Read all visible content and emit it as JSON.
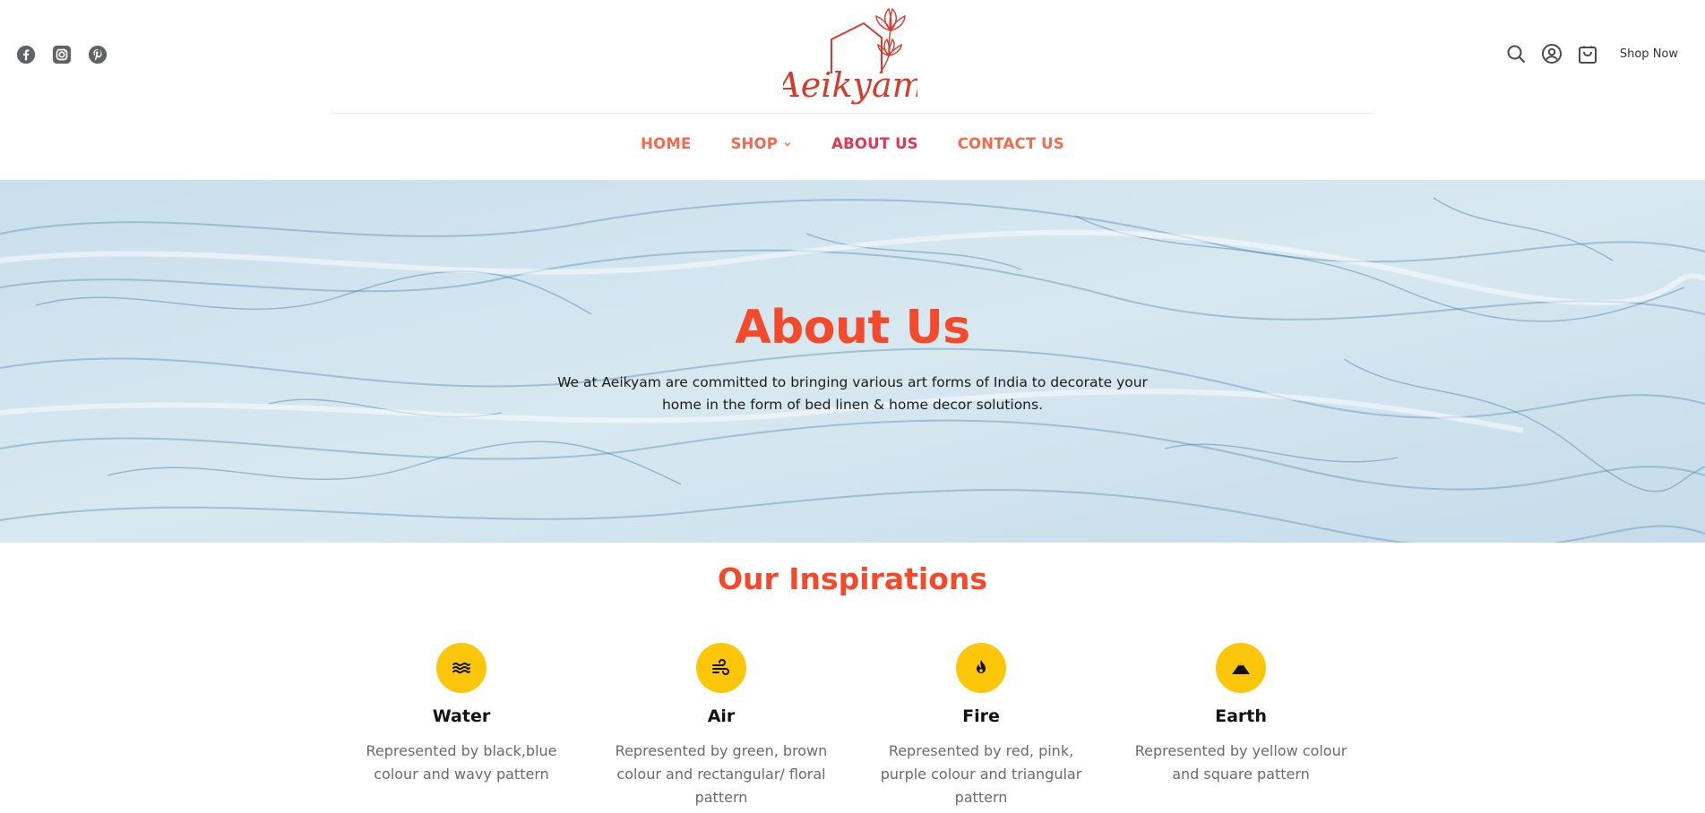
{
  "header": {
    "social_icons": [
      "facebook-icon",
      "instagram-icon",
      "pinterest-icon"
    ],
    "logo_text": "Aeikyam",
    "right_icons": [
      "search-icon",
      "account-icon",
      "cart-icon"
    ],
    "shop_now_label": "Shop Now"
  },
  "nav": {
    "items": [
      {
        "label": "HOME"
      },
      {
        "label": "SHOP"
      },
      {
        "label": "ABOUT US"
      },
      {
        "label": "CONTACT US"
      }
    ]
  },
  "hero": {
    "title": "About Us",
    "text": "We at Aeikyam are committed to bringing various art forms of India to decorate your home in the form of bed linen & home decor solutions."
  },
  "inspirations": {
    "title": "Our Inspirations",
    "items": [
      {
        "icon": "water-waves-icon",
        "title": "Water",
        "description": "Represented by black,blue colour and wavy pattern"
      },
      {
        "icon": "wind-icon",
        "title": "Air",
        "description": "Represented by green, brown colour and rectangular/ floral pattern"
      },
      {
        "icon": "flame-icon",
        "title": "Fire",
        "description": "Represented by red, pink, purple colour and triangular pattern"
      },
      {
        "icon": "mountain-icon",
        "title": "Earth",
        "description": "Represented by yellow colour and square pattern"
      }
    ]
  },
  "colors": {
    "accent": "#f34a2b",
    "nav": "#f26a4b",
    "nav_active": "#e2364f",
    "badge": "#fcc70a",
    "hero_bg": "#cfe3ee"
  }
}
